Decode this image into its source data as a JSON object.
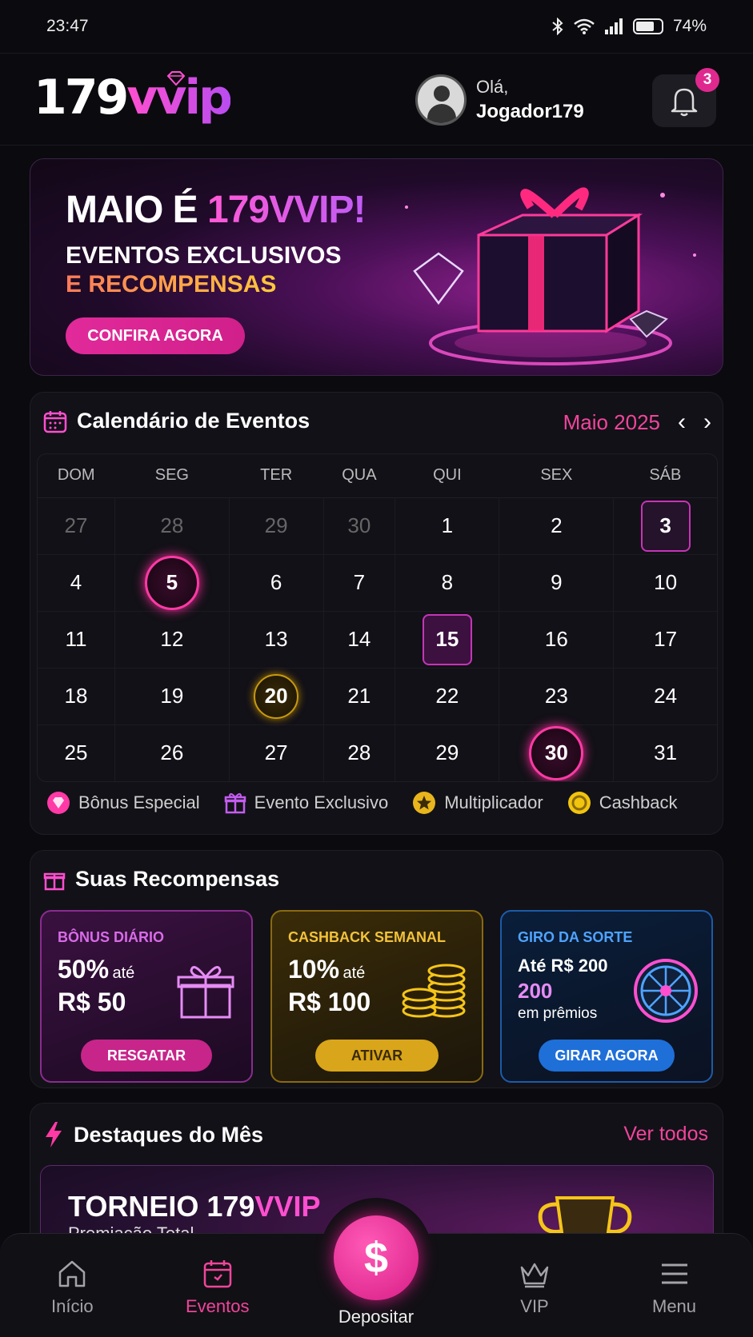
{
  "status": {
    "time": "23:47",
    "battery": "74%",
    "battery_level": 0.74
  },
  "header": {
    "logo_num": "179",
    "logo_vvip": "vvip",
    "greeting": "Olá,",
    "username": "Jogador179",
    "notifications": "3"
  },
  "banner": {
    "title_prefix": "MAIO É ",
    "title_accent": "179VVIP!",
    "line1": "EVENTOS EXCLUSIVOS",
    "line2": "E RECOMPENSAS",
    "button": "CONFIRA AGORA"
  },
  "calendar": {
    "title": "Calendário de Eventos",
    "month": "Maio 2025",
    "weekdays": [
      "DOM",
      "SEG",
      "TER",
      "QUA",
      "QUI",
      "SEX",
      "SÁB"
    ],
    "weeks": [
      [
        "27",
        "28",
        "29",
        "30",
        "1",
        "2",
        "3"
      ],
      [
        "4",
        "5",
        "6",
        "7",
        "8",
        "9",
        "10"
      ],
      [
        "11",
        "12",
        "13",
        "14",
        "15",
        "16",
        "17"
      ],
      [
        "18",
        "19",
        "20",
        "21",
        "22",
        "23",
        "24"
      ],
      [
        "25",
        "26",
        "27",
        "28",
        "29",
        "30",
        "31"
      ]
    ],
    "legend": [
      "Bônus Especial",
      "Evento Exclusivo",
      "Multiplicador",
      "Cashback"
    ],
    "colors": {
      "bonus": "#ff3aa6",
      "exclusive": "#c45cf0",
      "multiplier": "#e8b51c",
      "cashback": "#f1c40f"
    }
  },
  "rewards": {
    "title": "Suas Recompensas",
    "daily": {
      "label": "BÔNUS DIÁRIO",
      "pct": "50%",
      "upto": "até",
      "amount": "R$ 50",
      "button": "RESGATAR"
    },
    "weekly": {
      "label": "CASHBACK SEMANAL",
      "pct": "10%",
      "upto": "até",
      "amount": "R$ 100",
      "button": "ATIVAR"
    },
    "spin": {
      "label": "GIRO DA SORTE",
      "line1": "Até R$ 200",
      "line2": "200",
      "line3": "em prêmios",
      "button": "GIRAR AGORA"
    }
  },
  "highlights": {
    "title": "Destaques do Mês",
    "see_all": "Ver todos",
    "tournament_prefix": "TORNEIO 179",
    "tournament_accent": "VVIP",
    "subtitle": "Premiação Total"
  },
  "nav": {
    "home": "Início",
    "events": "Eventos",
    "deposit": "Depositar",
    "deposit_symbol": "$",
    "vip": "VIP",
    "menu": "Menu"
  }
}
